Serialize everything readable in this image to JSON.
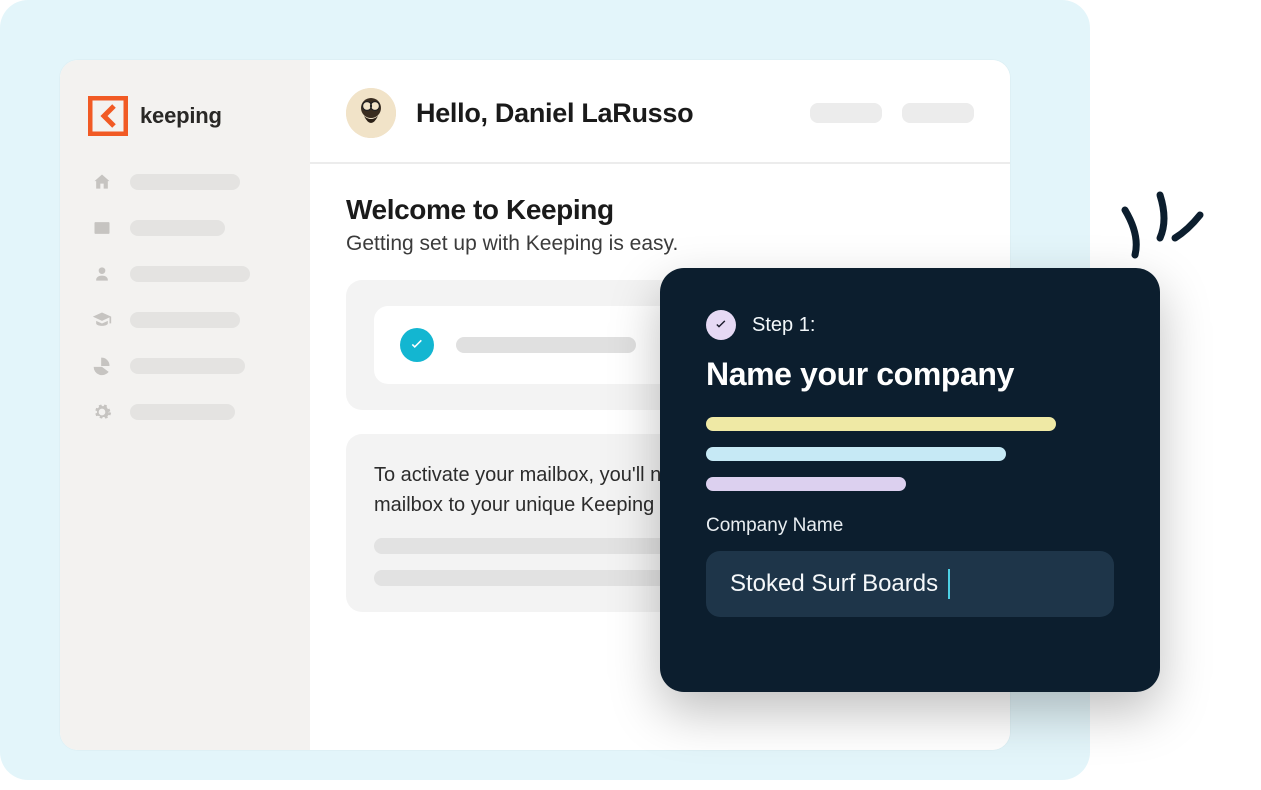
{
  "brand": {
    "name": "keeping"
  },
  "header": {
    "greeting": "Hello, Daniel LaRusso"
  },
  "welcome": {
    "title": "Welcome to Keeping",
    "subtitle": "Getting set up with Keeping is easy."
  },
  "activation": {
    "paragraph": "To activate your mailbox, you'll need to forward your support mailbox to your unique Keeping address."
  },
  "overlay": {
    "step_label": "Step 1:",
    "title": "Name your company",
    "field_label": "Company Name",
    "field_value": "Stoked Surf Boards"
  },
  "icons": {
    "home": "home-icon",
    "mail": "mail-icon",
    "user": "user-icon",
    "grad": "graduation-icon",
    "pie": "pie-chart-icon",
    "gear": "gear-icon"
  }
}
